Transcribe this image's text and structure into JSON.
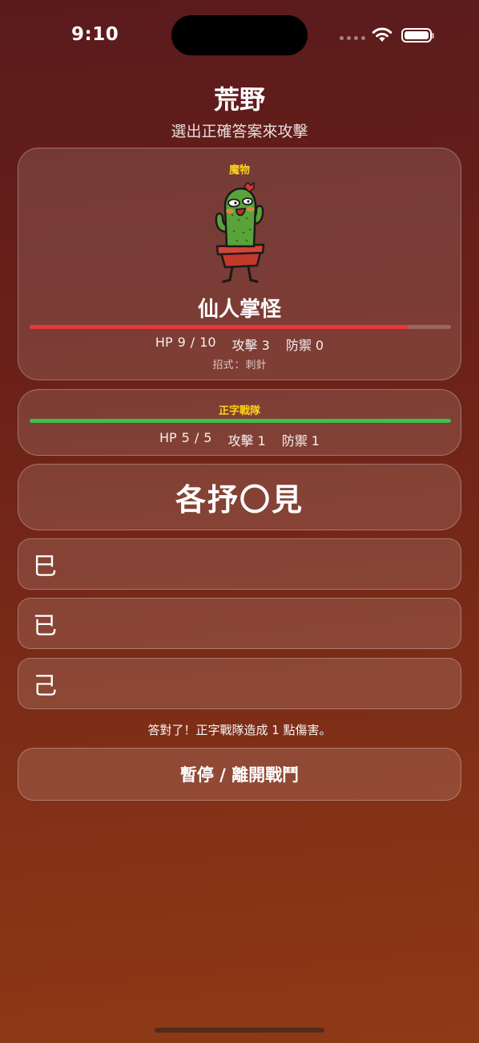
{
  "status_bar": {
    "time": "9:10"
  },
  "header": {
    "title": "荒野",
    "subtitle": "選出正確答案來攻擊"
  },
  "monster": {
    "section_label": "魔物",
    "image_icon": "cactus-monster-icon",
    "name": "仙人掌怪",
    "hp_label": "HP",
    "hp_current": "9",
    "hp_separator": "/",
    "hp_max": "10",
    "hp_fraction": 0.9,
    "attack": "攻擊 3",
    "defense": "防禦 0",
    "move_label": "招式",
    "move_sep": "：",
    "move_name": "刺針",
    "bar_color": "#e8383c"
  },
  "team": {
    "section_label": "正字戰隊",
    "hp_label": "HP",
    "hp_current": "5",
    "hp_separator": "/",
    "hp_max": "5",
    "hp_fraction": 1.0,
    "attack": "攻擊 1",
    "defense": "防禦 1",
    "bar_color": "#3ac24a"
  },
  "question": {
    "text": "各抒〇見"
  },
  "answers": [
    {
      "label": "巳"
    },
    {
      "label": "已"
    },
    {
      "label": "己"
    }
  ],
  "feedback": {
    "text": "答對了！正字戰隊造成 1 點傷害。"
  },
  "pause_button": {
    "label": "暫停 / 離開戰鬥"
  },
  "colors": {
    "label_accent": "#ffd21a",
    "background_top": "#5a1a1c",
    "background_bottom": "#8f3a16"
  }
}
